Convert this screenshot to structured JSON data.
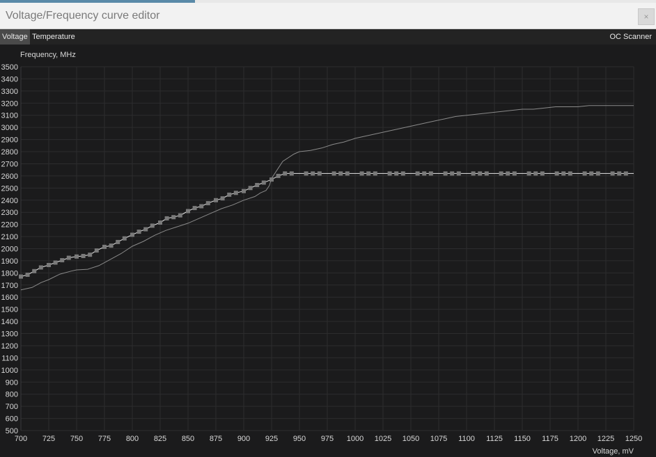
{
  "window": {
    "title": "Voltage/Frequency curve editor",
    "close_glyph": "×"
  },
  "tabs": [
    {
      "label": "Voltage",
      "active": true
    },
    {
      "label": "Temperature",
      "active": false
    }
  ],
  "oc_scanner_label": "OC Scanner",
  "chart_data": {
    "type": "line",
    "ylabel": "Frequency, MHz",
    "xlabel": "Voltage, mV",
    "xlim": [
      700,
      1250
    ],
    "ylim": [
      500,
      3500
    ],
    "x_ticks": [
      700,
      725,
      750,
      775,
      800,
      825,
      850,
      875,
      900,
      925,
      950,
      975,
      1000,
      1025,
      1050,
      1075,
      1100,
      1125,
      1150,
      1175,
      1200,
      1225,
      1250
    ],
    "y_ticks": [
      500,
      600,
      700,
      800,
      900,
      1000,
      1100,
      1200,
      1300,
      1400,
      1500,
      1600,
      1700,
      1800,
      1900,
      2000,
      2100,
      2200,
      2300,
      2400,
      2500,
      2600,
      2700,
      2800,
      2900,
      3000,
      3100,
      3200,
      3300,
      3400,
      3500
    ],
    "grid": true,
    "colors": {
      "background": "#1b1b1c",
      "grid": "#2c2c2e",
      "axis_text": "#d8d8d8",
      "curve": "#e6e6e6",
      "default_curve": "#8a8a8a",
      "point": "#7a7a7a"
    },
    "series": [
      {
        "x": [
          700,
          706,
          712,
          718,
          725,
          731,
          737,
          743,
          750,
          756,
          762,
          768,
          775,
          781,
          787,
          793,
          800,
          806,
          812,
          818,
          825,
          831,
          837,
          843,
          850,
          856,
          862,
          868,
          875,
          881,
          887,
          893,
          900,
          906,
          912,
          918,
          925,
          931,
          937,
          943,
          950,
          956,
          962,
          968,
          975,
          981,
          987,
          993,
          1000,
          1006,
          1012,
          1018,
          1025,
          1031,
          1037,
          1043,
          1050,
          1056,
          1062,
          1068,
          1075,
          1081,
          1087,
          1093,
          1100,
          1106,
          1112,
          1118,
          1125,
          1131,
          1137,
          1143,
          1150,
          1156,
          1162,
          1168,
          1175,
          1181,
          1187,
          1193,
          1200,
          1206,
          1212,
          1218,
          1225,
          1231,
          1237,
          1243,
          1250
        ],
        "y": [
          1770,
          1785,
          1815,
          1845,
          1865,
          1885,
          1905,
          1925,
          1935,
          1940,
          1950,
          1985,
          2015,
          2025,
          2055,
          2085,
          2115,
          2140,
          2160,
          2190,
          2215,
          2250,
          2260,
          2275,
          2310,
          2335,
          2350,
          2375,
          2400,
          2415,
          2445,
          2460,
          2475,
          2500,
          2525,
          2545,
          2570,
          2600,
          2620,
          2620,
          2620,
          2620,
          2620,
          2620,
          2620,
          2620,
          2620,
          2620,
          2620,
          2620,
          2620,
          2620,
          2620,
          2620,
          2620,
          2620,
          2620,
          2620,
          2620,
          2620,
          2620,
          2620,
          2620,
          2620,
          2620,
          2620,
          2620,
          2620,
          2620,
          2620,
          2620,
          2620,
          2620,
          2620,
          2620,
          2620,
          2620,
          2620,
          2620,
          2620,
          2620,
          2620,
          2620,
          2620,
          2620,
          2620,
          2620,
          2620,
          2620
        ]
      },
      {
        "x": [
          700,
          710,
          718,
          725,
          735,
          745,
          750,
          760,
          770,
          780,
          790,
          800,
          810,
          820,
          830,
          840,
          850,
          860,
          870,
          880,
          890,
          900,
          910,
          915,
          920,
          923,
          925,
          930,
          935,
          945,
          950,
          960,
          970,
          980,
          990,
          1000,
          1010,
          1020,
          1030,
          1040,
          1050,
          1060,
          1070,
          1080,
          1090,
          1100,
          1110,
          1120,
          1130,
          1140,
          1150,
          1160,
          1170,
          1180,
          1190,
          1200,
          1210,
          1220,
          1230,
          1240,
          1250
        ],
        "y": [
          1660,
          1680,
          1720,
          1745,
          1790,
          1815,
          1825,
          1830,
          1860,
          1910,
          1960,
          2020,
          2060,
          2110,
          2150,
          2180,
          2210,
          2250,
          2290,
          2330,
          2360,
          2400,
          2430,
          2460,
          2480,
          2520,
          2580,
          2650,
          2720,
          2780,
          2800,
          2810,
          2830,
          2860,
          2880,
          2910,
          2930,
          2950,
          2970,
          2990,
          3010,
          3030,
          3050,
          3070,
          3090,
          3100,
          3110,
          3120,
          3130,
          3140,
          3150,
          3150,
          3160,
          3170,
          3170,
          3170,
          3180,
          3180,
          3180,
          3180,
          3180
        ]
      }
    ]
  }
}
